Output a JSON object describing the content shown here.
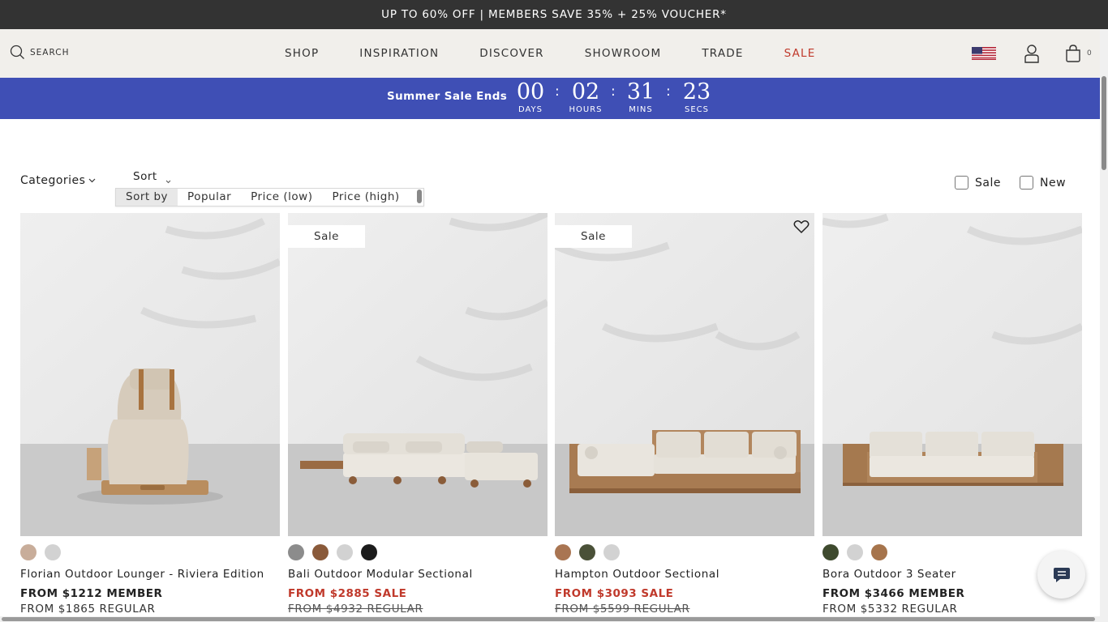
{
  "promo": {
    "text": "UP TO 60% OFF | MEMBERS SAVE 35% + 25% VOUCHER*"
  },
  "header": {
    "search_label": "SEARCH",
    "nav": [
      {
        "label": "SHOP"
      },
      {
        "label": "INSPIRATION"
      },
      {
        "label": "DISCOVER"
      },
      {
        "label": "SHOWROOM"
      },
      {
        "label": "TRADE"
      },
      {
        "label": "SALE"
      }
    ],
    "cart_count": "0",
    "icons": [
      "search-icon",
      "us-flag-icon",
      "account-icon",
      "cart-icon"
    ],
    "sale_color": "#c0392b"
  },
  "countdown": {
    "label": "Summer Sale Ends",
    "units": [
      {
        "value": "00",
        "caption": "DAYS"
      },
      {
        "value": "02",
        "caption": "HOURS"
      },
      {
        "value": "31",
        "caption": "MINS"
      },
      {
        "value": "23",
        "caption": "SECS"
      }
    ],
    "separator": ":",
    "background": "#3f4fb5"
  },
  "filters": {
    "categories_label": "Categories",
    "sort_label": "Sort",
    "sort_options": [
      "Sort by",
      "Popular",
      "Price (low)",
      "Price (high)"
    ],
    "selected_sort": "Sort by",
    "sale_label": "Sale",
    "new_label": "New"
  },
  "products": [
    {
      "name": "Florian Outdoor Lounger - Riviera Edition",
      "badge": "",
      "swatches": [
        "#c8ad9a",
        "#d2d2d2"
      ],
      "price_primary": "FROM $1212 MEMBER",
      "price_secondary": "FROM $1865 REGULAR"
    },
    {
      "name": "Bali Outdoor Modular Sectional",
      "badge": "Sale",
      "swatches": [
        "#8c8c8c",
        "#8a5a3a",
        "#d2d2d2",
        "#1c1c1c"
      ],
      "price_primary": "FROM $2885 SALE",
      "price_secondary": "FROM $4932 REGULAR"
    },
    {
      "name": "Hampton Outdoor Sectional",
      "badge": "Sale",
      "swatches": [
        "#a97552",
        "#4a5138",
        "#d2d2d2"
      ],
      "price_primary": "FROM $3093 SALE",
      "price_secondary": "FROM $5599 REGULAR"
    },
    {
      "name": "Bora Outdoor 3 Seater",
      "badge": "",
      "swatches": [
        "#3e4a2e",
        "#d2d2d2",
        "#a6744c"
      ],
      "price_primary": "FROM $3466 MEMBER",
      "price_secondary": "FROM $5332 REGULAR"
    }
  ]
}
